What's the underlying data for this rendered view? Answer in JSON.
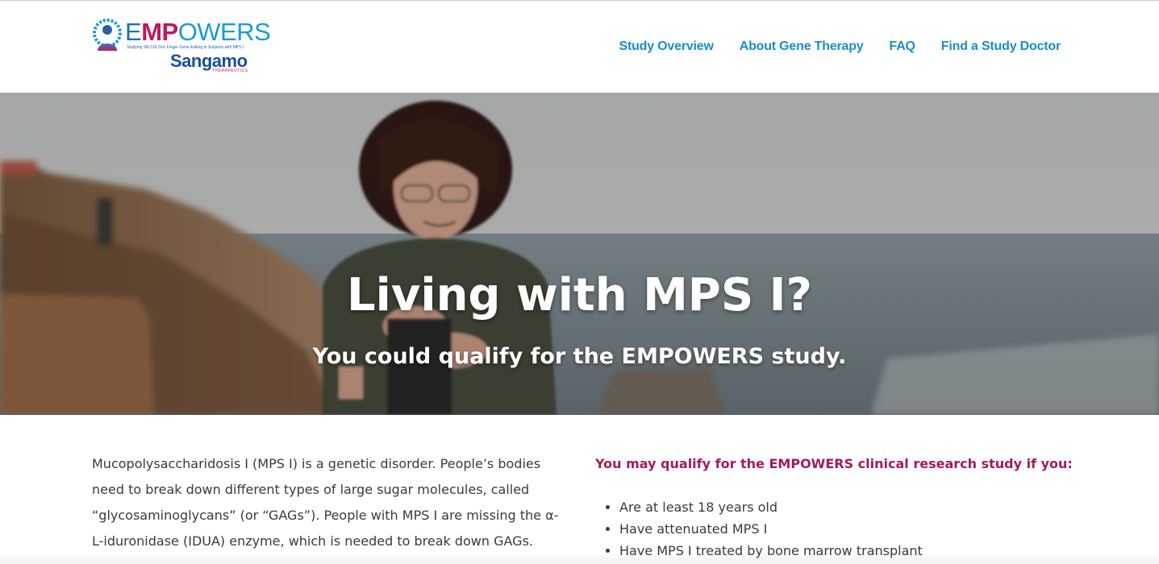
{
  "logo": {
    "word_e": "E",
    "word_mp": "MP",
    "word_rest": "OWERS",
    "tagline": "Studying SB-318 Zinc Finger Gene Editing in Subjects with MPS I",
    "company": "Sangamo",
    "company_sub": "THERAPEUTICS",
    "emblem_icon": "person-gear-emblem-icon"
  },
  "nav": {
    "items": [
      {
        "label": "Study Overview"
      },
      {
        "label": "About Gene Therapy"
      },
      {
        "label": "FAQ"
      },
      {
        "label": "Find a Study Doctor"
      }
    ]
  },
  "hero": {
    "title": "Living with MPS I?",
    "subtitle": "You could qualify for the EMPOWERS study.",
    "image_icon": "woman-by-sea-photo"
  },
  "intro": {
    "text": "Mucopolysaccharidosis I (MPS I) is a genetic disorder. People’s bodies need to break down different types of large sugar molecules, called “glycosaminoglycans” (or “GAGs”). People with MPS I are missing the α-L-iduronidase (IDUA) enzyme, which is needed to break down GAGs."
  },
  "qualify": {
    "heading": "You may qualify for the EMPOWERS clinical research study if you:",
    "criteria": [
      "Are at least 18 years old",
      "Have attenuated MPS I",
      "Have MPS I treated by bone marrow transplant"
    ]
  },
  "colors": {
    "nav": "#1a8dc7",
    "accent_magenta": "#a51a5a",
    "brand_blue": "#1a4f9c"
  }
}
